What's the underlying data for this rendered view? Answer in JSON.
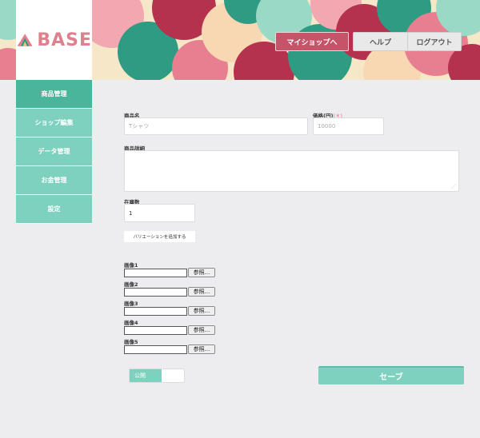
{
  "brand": {
    "logo_text": "BASE",
    "accent": "#e07f8e"
  },
  "header": {
    "myshop_label": "マイショップへ",
    "help_label": "ヘルプ",
    "logout_label": "ログアウト"
  },
  "sidebar": {
    "items": [
      {
        "label": "商品管理",
        "active": true
      },
      {
        "label": "ショップ編集"
      },
      {
        "label": "データ管理"
      },
      {
        "label": "お金管理"
      },
      {
        "label": "設定"
      }
    ]
  },
  "form": {
    "name_label": "商品名",
    "name_value": "Tシャツ",
    "price_label": "価格(円)",
    "price_required": "(＊)",
    "price_value": "10000",
    "detail_label": "商品詳細",
    "detail_value": "",
    "stock_label": "在庫数",
    "stock_value": "1",
    "variation_button": "バリエーションを追加する",
    "images": [
      {
        "label": "画像1",
        "browse": "参照..."
      },
      {
        "label": "画像2",
        "browse": "参照..."
      },
      {
        "label": "画像3",
        "browse": "参照..."
      },
      {
        "label": "画像4",
        "browse": "参照..."
      },
      {
        "label": "画像5",
        "browse": "参照..."
      }
    ],
    "publish_label": "公開",
    "save_label": "セーブ"
  },
  "colors": {
    "teal": "#7dd1be",
    "teal_active": "#4ab59b",
    "crimson": "#c55469",
    "background": "#ededf0"
  }
}
